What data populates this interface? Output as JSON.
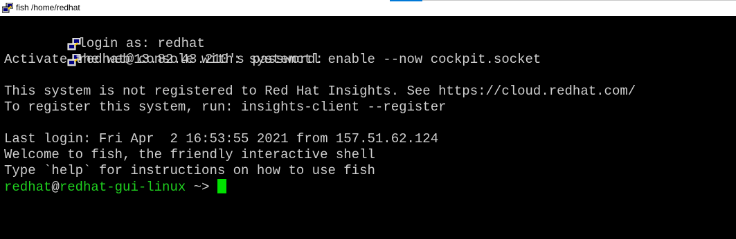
{
  "window": {
    "title": "fish /home/redhat",
    "accent_color": "#0078d7"
  },
  "terminal": {
    "background": "#000000",
    "text_color": "#cfcfcf",
    "prompt_color": "#1fd11f",
    "cursor_color": "#00e000",
    "login_line": "login as: redhat",
    "password_line": "redhat@13.82.43.210's password:",
    "console_line": "Activate the web console with: systemctl enable --now cockpit.socket",
    "insights_line": "This system is not registered to Red Hat Insights. See https://cloud.redhat.com/",
    "register_line": "To register this system, run: insights-client --register",
    "last_login_line": "Last login: Fri Apr  2 16:53:55 2021 from 157.51.62.124",
    "welcome_line": "Welcome to fish, the friendly interactive shell",
    "help_line": "Type `help` for instructions on how to use fish",
    "prompt": {
      "user": "redhat",
      "at": "@",
      "host": "redhat-gui-linux",
      "cwd": " ~",
      "symbol": "> "
    }
  },
  "icons": {
    "window_icon": "putty-icon",
    "login_icon": "putty-icon",
    "password_icon": "putty-icon"
  }
}
